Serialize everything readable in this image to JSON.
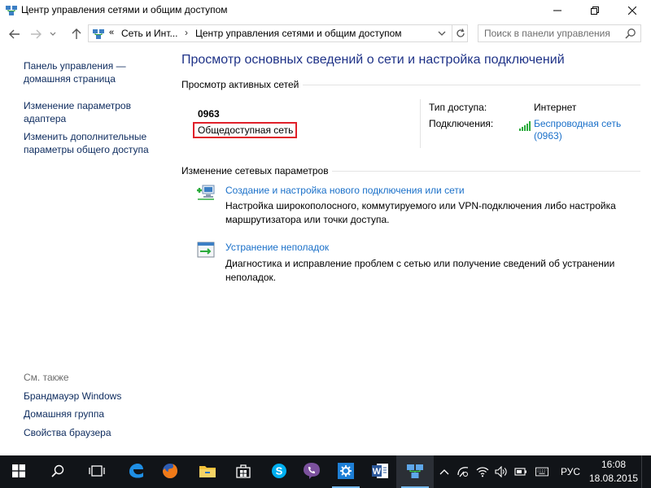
{
  "window": {
    "title": "Центр управления сетями и общим доступом"
  },
  "address": {
    "prefix": "«",
    "crumb1": "Сеть и Инт...",
    "separator": "›",
    "crumb2": "Центр управления сетями и общим доступом"
  },
  "search": {
    "placeholder": "Поиск в панели управления"
  },
  "sidebar": {
    "links": [
      "Панель управления —",
      "домашняя страница",
      "Изменение параметров",
      "адаптера",
      "Изменить дополнительные",
      "параметры общего доступа"
    ],
    "see_also": "См. также",
    "see_also_links": [
      "Брандмауэр Windows",
      "Домашняя группа",
      "Свойства браузера"
    ]
  },
  "main": {
    "title": "Просмотр основных сведений о сети и настройка подключений",
    "active_networks_heading": "Просмотр активных сетей",
    "network": {
      "name": "0963",
      "type": "Общедоступная сеть",
      "access_label": "Тип доступа:",
      "access_value": "Интернет",
      "connections_label": "Подключения:",
      "connection_link_line1": "Беспроводная сеть",
      "connection_link_line2": "(0963)"
    },
    "change_heading": "Изменение сетевых параметров",
    "tasks": [
      {
        "link": "Создание и настройка нового подключения или сети",
        "desc": "Настройка широкополосного, коммутируемого или VPN-подключения либо настройка маршрутизатора или точки доступа.",
        "icon": "new-connection-icon"
      },
      {
        "link": "Устранение неполадок",
        "desc": "Диагностика и исправление проблем с сетью или получение сведений об устранении неполадок.",
        "icon": "troubleshoot-icon"
      }
    ]
  },
  "taskbar": {
    "items": [
      "start-icon",
      "search-icon",
      "task-view-icon",
      "edge-icon",
      "firefox-icon",
      "explorer-icon",
      "store-icon",
      "skype-icon",
      "viber-icon",
      "settings-icon",
      "word-icon",
      "network-center-icon"
    ],
    "language": "РУС",
    "time": "16:08",
    "date": "18.08.2015"
  },
  "colors": {
    "link": "#1a70c9",
    "title": "#1e3287",
    "highlight_border": "#e0202a",
    "taskbar": "#111418"
  }
}
